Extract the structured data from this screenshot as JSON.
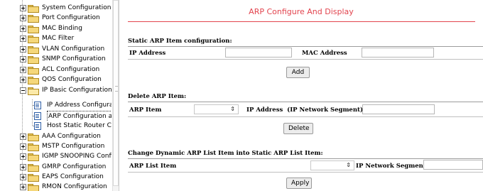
{
  "sidebar": {
    "items": [
      {
        "label": "System Configuration",
        "state": "collapsed"
      },
      {
        "label": "Port Configuration",
        "state": "collapsed"
      },
      {
        "label": "MAC Binding",
        "state": "collapsed"
      },
      {
        "label": "MAC Filter",
        "state": "collapsed"
      },
      {
        "label": "VLAN Configuration",
        "state": "collapsed"
      },
      {
        "label": "SNMP Configuration",
        "state": "collapsed"
      },
      {
        "label": "ACL Configuration",
        "state": "collapsed"
      },
      {
        "label": "QOS Configuration",
        "state": "collapsed"
      },
      {
        "label": "IP Basic Configuration",
        "state": "expanded",
        "children": [
          {
            "label": "IP Address Configurati"
          },
          {
            "label": "ARP Configuration and",
            "selected": true
          },
          {
            "label": "Host Static Router Co"
          }
        ]
      },
      {
        "label": "AAA Configuration",
        "state": "collapsed"
      },
      {
        "label": "MSTP Configuration",
        "state": "collapsed"
      },
      {
        "label": "IGMP SNOOPING Config",
        "state": "collapsed"
      },
      {
        "label": "GMRP Configuration",
        "state": "collapsed"
      },
      {
        "label": "EAPS Configuration",
        "state": "collapsed"
      },
      {
        "label": "RMON Configuration",
        "state": "collapsed"
      }
    ]
  },
  "main": {
    "title": "ARP Configure And Display",
    "static": {
      "section_title": "Static ARP Item configuration:",
      "ip_label": "IP Address",
      "ip_value": "",
      "mac_label": "MAC Address",
      "mac_value": "",
      "button": "Add"
    },
    "delete": {
      "section_title": "Delete ARP Item:",
      "arp_item_label": "ARP Item",
      "arp_item_selected": "",
      "ip_label": "IP Address  (IP Network Segment)",
      "ip_value": "",
      "button": "Delete"
    },
    "change": {
      "section_title": "Change Dynamic ARP List Item into Static ARP List Item:",
      "arp_list_label": "ARP List Item",
      "arp_list_selected": "",
      "segment_label": "IP Network Segment",
      "segment_value": "",
      "button": "Apply"
    }
  },
  "icons": {
    "collapsed": "plus-expander-icon",
    "expanded": "minus-expander-icon",
    "folder": "folder-icon",
    "page": "page-icon",
    "select_arrow": "up-down-arrow-icon"
  },
  "colors": {
    "title": "#e2444e",
    "folder": "#f5d77a",
    "page_icon": "#2f5fa6"
  }
}
